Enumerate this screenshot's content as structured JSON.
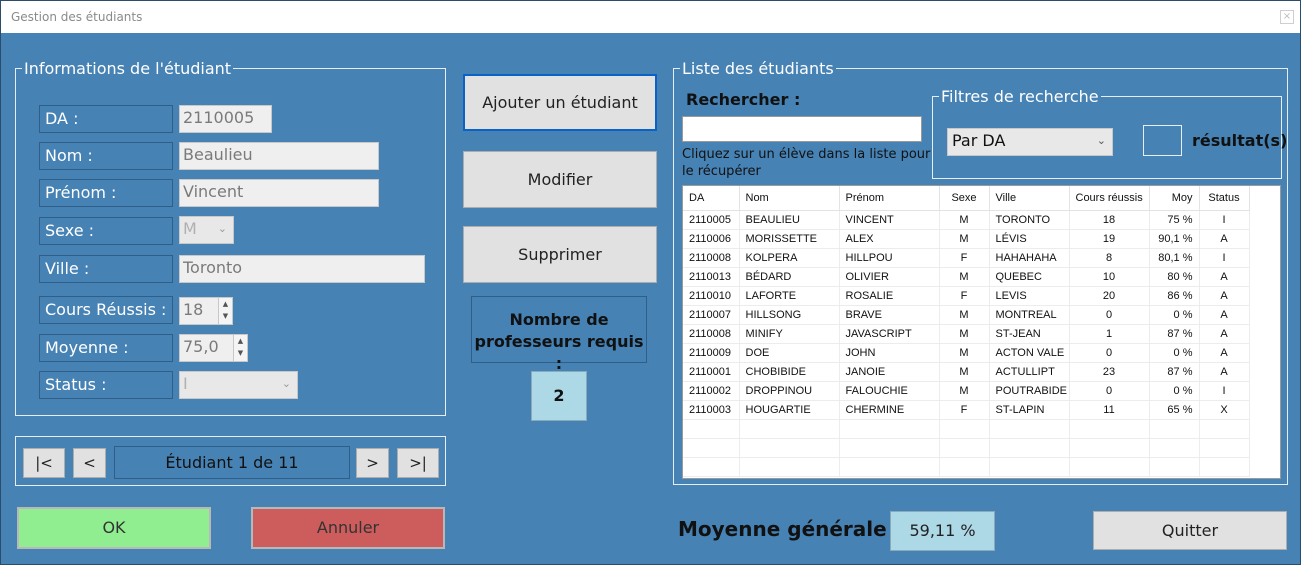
{
  "window": {
    "title": "Gestion des étudiants",
    "close_label": "×"
  },
  "student_info": {
    "legend": "Informations de l'étudiant",
    "da_label": "DA :",
    "da_value": "2110005",
    "nom_label": "Nom :",
    "nom_value": "Beaulieu",
    "prenom_label": "Prénom :",
    "prenom_value": "Vincent",
    "sexe_label": "Sexe :",
    "sexe_value": "M",
    "ville_label": "Ville :",
    "ville_value": "Toronto",
    "cours_label": "Cours Réussis :",
    "cours_value": "18",
    "moyenne_label": "Moyenne :",
    "moyenne_value": "75,0",
    "status_label": "Status :",
    "status_value": "I"
  },
  "actions": {
    "add_label": "Ajouter un étudiant",
    "modify_label": "Modifier",
    "delete_label": "Supprimer",
    "prof_label": "Nombre de professeurs requis :",
    "prof_value": "2"
  },
  "navigation": {
    "first_label": "|<",
    "prev_label": "<",
    "position_label": "Étudiant 1 de 11",
    "next_label": ">",
    "last_label": ">|"
  },
  "footer": {
    "ok_label": "OK",
    "cancel_label": "Annuler",
    "avg_label": "Moyenne générale :",
    "avg_value": "59,11 %",
    "quit_label": "Quitter"
  },
  "list": {
    "legend": "Liste des étudiants",
    "search_label": "Rechercher :",
    "search_value": "",
    "hint": "Cliquez sur un élève dans la liste pour le récupérer",
    "filter_legend": "Filtres de recherche",
    "filter_value": "Par DA",
    "results_count": "",
    "results_label": "résultat(s)",
    "columns": [
      "DA",
      "Nom",
      "Prénom",
      "Sexe",
      "Ville",
      "Cours réussis",
      "Moy",
      "Status"
    ],
    "rows": [
      [
        "2110005",
        "BEAULIEU",
        "VINCENT",
        "M",
        "TORONTO",
        "18",
        "75 %",
        "I"
      ],
      [
        "2110006",
        "MORISSETTE",
        "ALEX",
        "M",
        "LÉVIS",
        "19",
        "90,1 %",
        "A"
      ],
      [
        "2110008",
        "KOLPERA",
        "HILLPOU",
        "F",
        "HAHAHAHA",
        "8",
        "80,1 %",
        "I"
      ],
      [
        "2110013",
        "BÉDARD",
        "OLIVIER",
        "M",
        "QUEBEC",
        "10",
        "80 %",
        "A"
      ],
      [
        "2110010",
        "LAFORTE",
        "ROSALIE",
        "F",
        "LEVIS",
        "20",
        "86 %",
        "A"
      ],
      [
        "2110007",
        "HILLSONG",
        "BRAVE",
        "M",
        "MONTREAL",
        "0",
        "0 %",
        "A"
      ],
      [
        "2110008",
        "MINIFY",
        "JAVASCRIPT",
        "M",
        "ST-JEAN",
        "1",
        "87 %",
        "A"
      ],
      [
        "2110009",
        "DOE",
        "JOHN",
        "M",
        "ACTON VALE",
        "0",
        "0 %",
        "A"
      ],
      [
        "2110001",
        "CHOBIBIDE",
        "JANOIE",
        "M",
        "ACTULLIPT",
        "23",
        "87 %",
        "A"
      ],
      [
        "2110002",
        "DROPPINOU",
        "FALOUCHIE",
        "M",
        "POUTRABIDE",
        "0",
        "0 %",
        "I"
      ],
      [
        "2110003",
        "HOUGARTIE",
        "CHERMINE",
        "F",
        "ST-LAPIN",
        "11",
        "65 %",
        "X"
      ]
    ]
  },
  "colors": {
    "background": "#4682b4",
    "ok": "#90ee90",
    "cancel": "#cd5c5c",
    "highlight": "#add8e6"
  }
}
